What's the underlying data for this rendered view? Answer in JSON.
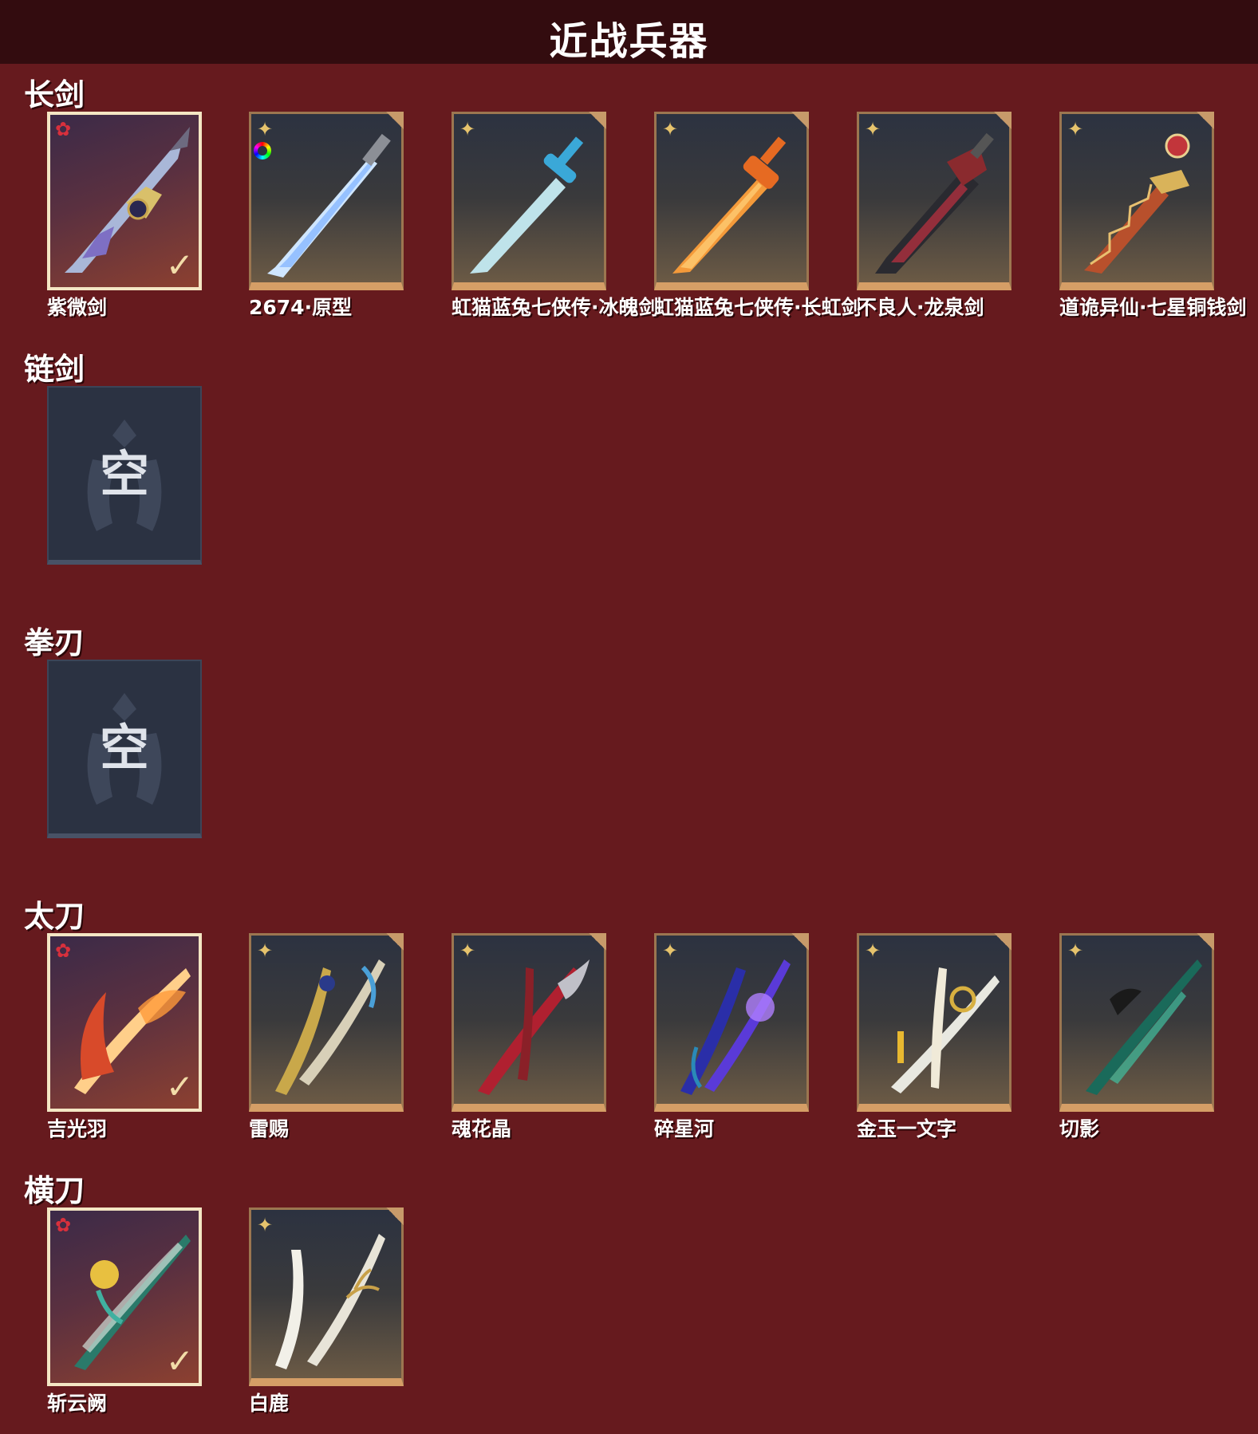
{
  "header": {
    "title": "近战兵器"
  },
  "sections": [
    {
      "title": "长剑",
      "items": [
        {
          "name": "紫微剑",
          "selected": true
        },
        {
          "name": "2674·原型"
        },
        {
          "name": "虹猫蓝兔七侠传·冰魄剑"
        },
        {
          "name": "虹猫蓝兔七侠传·长虹剑"
        },
        {
          "name": "不良人·龙泉剑"
        },
        {
          "name": "道诡异仙·七星铜钱剑"
        }
      ]
    },
    {
      "title": "链剑",
      "empty_label": "空"
    },
    {
      "title": "拳刃",
      "empty_label": "空"
    },
    {
      "title": "太刀",
      "items": [
        {
          "name": "吉光羽",
          "selected": true
        },
        {
          "name": "雷赐"
        },
        {
          "name": "魂花晶"
        },
        {
          "name": "碎星河"
        },
        {
          "name": "金玉一文字"
        },
        {
          "name": "切影"
        }
      ]
    },
    {
      "title": "横刀",
      "items": [
        {
          "name": "斩云阙",
          "selected": true
        },
        {
          "name": "白鹿"
        }
      ]
    }
  ],
  "icons": {
    "rarity_selected": "red-star-icon",
    "rarity_normal": "gold-star-icon",
    "check": "checkmark-icon",
    "color_wheel": "color-wheel-icon"
  },
  "colors": {
    "background": "#661a1e",
    "header": "#330c0f",
    "card_gold": "#d59e66",
    "selected_frame": "#f4e6c4"
  }
}
